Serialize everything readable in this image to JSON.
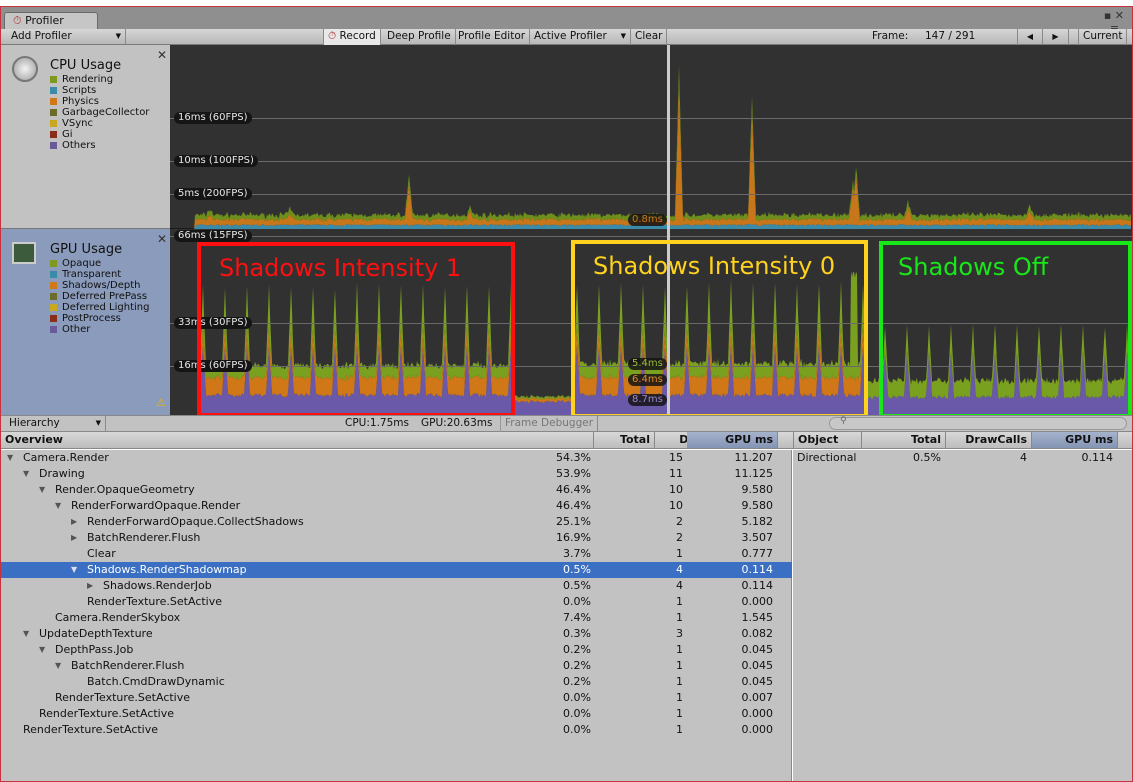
{
  "window": {
    "tab": "Profiler",
    "tab_icon": "stopwatch-icon"
  },
  "toolbar": {
    "add_profiler": "Add Profiler",
    "record": "Record",
    "deep_profile": "Deep Profile",
    "profiler_editor": "Profile Editor",
    "active_profiler": "Active Profiler",
    "clear": "Clear",
    "frame_label": "Frame:",
    "frame_value": "147 / 291",
    "current": "Current"
  },
  "cpu": {
    "title": "CPU Usage",
    "legend": [
      {
        "label": "Rendering",
        "color": "#7d9a1e"
      },
      {
        "label": "Scripts",
        "color": "#3b8aa8"
      },
      {
        "label": "Physics",
        "color": "#d07818"
      },
      {
        "label": "GarbageCollector",
        "color": "#6b6b2a"
      },
      {
        "label": "VSync",
        "color": "#c8a81e"
      },
      {
        "label": "Gi",
        "color": "#8a2e1a"
      },
      {
        "label": "Others",
        "color": "#6a5a9a"
      }
    ],
    "axis": [
      "16ms (60FPS)",
      "10ms (100FPS)",
      "5ms (200FPS)"
    ],
    "selected_value": "0.8ms"
  },
  "gpu": {
    "title": "GPU Usage",
    "legend": [
      {
        "label": "Opaque",
        "color": "#7d9a1e"
      },
      {
        "label": "Transparent",
        "color": "#3b8aa8"
      },
      {
        "label": "Shadows/Depth",
        "color": "#d07818"
      },
      {
        "label": "Deferred PrePass",
        "color": "#6b6b2a"
      },
      {
        "label": "Deferred Lighting",
        "color": "#c8a81e"
      },
      {
        "label": "PostProcess",
        "color": "#8a2e1a"
      },
      {
        "label": "Other",
        "color": "#6a5a9a"
      }
    ],
    "axis": [
      "66ms (15FPS)",
      "33ms (30FPS)",
      "16ms (60FPS)"
    ],
    "selected_values": [
      "5.4ms",
      "6.4ms",
      "8.7ms"
    ]
  },
  "annotations": [
    {
      "text": "Shadows Intensity 1",
      "color": "#ff1010"
    },
    {
      "text": "Shadows Intensity 0",
      "color": "#ffd21e"
    },
    {
      "text": "Shadows Off",
      "color": "#18e818"
    }
  ],
  "status": {
    "view": "Hierarchy",
    "cpu": "CPU:1.75ms",
    "gpu": "GPU:20.63ms",
    "frame_debugger": "Frame Debugger"
  },
  "tree": {
    "headers": [
      "Overview",
      "Total",
      "DrawCalls",
      "GPU ms"
    ],
    "rows": [
      {
        "name": "Camera.Render",
        "total": "54.3%",
        "calls": "15",
        "gpu": "11.207",
        "depth": 0,
        "arrow": "open"
      },
      {
        "name": "Drawing",
        "total": "53.9%",
        "calls": "11",
        "gpu": "11.125",
        "depth": 1,
        "arrow": "open"
      },
      {
        "name": "Render.OpaqueGeometry",
        "total": "46.4%",
        "calls": "10",
        "gpu": "9.580",
        "depth": 2,
        "arrow": "open"
      },
      {
        "name": "RenderForwardOpaque.Render",
        "total": "46.4%",
        "calls": "10",
        "gpu": "9.580",
        "depth": 3,
        "arrow": "open"
      },
      {
        "name": "RenderForwardOpaque.CollectShadows",
        "total": "25.1%",
        "calls": "2",
        "gpu": "5.182",
        "depth": 4,
        "arrow": "closed"
      },
      {
        "name": "BatchRenderer.Flush",
        "total": "16.9%",
        "calls": "2",
        "gpu": "3.507",
        "depth": 4,
        "arrow": "closed"
      },
      {
        "name": "Clear",
        "total": "3.7%",
        "calls": "1",
        "gpu": "0.777",
        "depth": 4,
        "arrow": "none"
      },
      {
        "name": "Shadows.RenderShadowmap",
        "total": "0.5%",
        "calls": "4",
        "gpu": "0.114",
        "depth": 4,
        "arrow": "open",
        "selected": true
      },
      {
        "name": "Shadows.RenderJob",
        "total": "0.5%",
        "calls": "4",
        "gpu": "0.114",
        "depth": 5,
        "arrow": "closed"
      },
      {
        "name": "RenderTexture.SetActive",
        "total": "0.0%",
        "calls": "1",
        "gpu": "0.000",
        "depth": 4,
        "arrow": "none"
      },
      {
        "name": "Camera.RenderSkybox",
        "total": "7.4%",
        "calls": "1",
        "gpu": "1.545",
        "depth": 2,
        "arrow": "none"
      },
      {
        "name": "UpdateDepthTexture",
        "total": "0.3%",
        "calls": "3",
        "gpu": "0.082",
        "depth": 1,
        "arrow": "open"
      },
      {
        "name": "DepthPass.Job",
        "total": "0.2%",
        "calls": "1",
        "gpu": "0.045",
        "depth": 2,
        "arrow": "open"
      },
      {
        "name": "BatchRenderer.Flush",
        "total": "0.2%",
        "calls": "1",
        "gpu": "0.045",
        "depth": 3,
        "arrow": "open"
      },
      {
        "name": "Batch.CmdDrawDynamic",
        "total": "0.2%",
        "calls": "1",
        "gpu": "0.045",
        "depth": 4,
        "arrow": "none"
      },
      {
        "name": "RenderTexture.SetActive",
        "total": "0.0%",
        "calls": "1",
        "gpu": "0.007",
        "depth": 2,
        "arrow": "none"
      },
      {
        "name": "RenderTexture.SetActive",
        "total": "0.0%",
        "calls": "1",
        "gpu": "0.000",
        "depth": 1,
        "arrow": "none"
      },
      {
        "name": "RenderTexture.SetActive",
        "total": "0.0%",
        "calls": "1",
        "gpu": "0.000",
        "depth": 0,
        "arrow": "none"
      }
    ]
  },
  "objects": {
    "headers": [
      "Object",
      "Total",
      "DrawCalls",
      "GPU ms"
    ],
    "rows": [
      {
        "name": "Directional",
        "total": "0.5%",
        "calls": "4",
        "gpu": "0.114"
      }
    ]
  }
}
